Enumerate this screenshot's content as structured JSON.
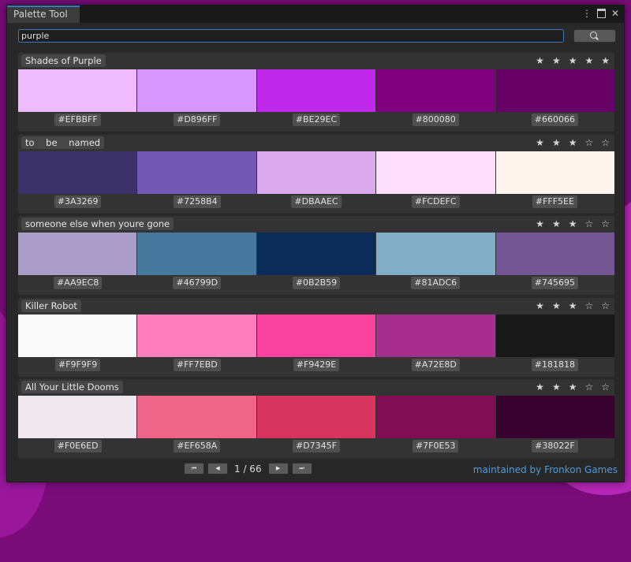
{
  "window": {
    "title": "Palette Tool",
    "menu_icon": "⋮",
    "maximize_icon": "□",
    "close_icon": "✕"
  },
  "search": {
    "value": "purple"
  },
  "palettes": [
    {
      "name": "Shades of Purple",
      "rating": 5,
      "colors": [
        "#EFBBFF",
        "#D896FF",
        "#BE29EC",
        "#800080",
        "#660066"
      ]
    },
    {
      "name": "to    be    named",
      "rating": 3,
      "colors": [
        "#3A3269",
        "#7258B4",
        "#DBAAEC",
        "#FCDEFC",
        "#FFF5EE"
      ]
    },
    {
      "name": "someone else when youre gone",
      "rating": 3,
      "colors": [
        "#AA9EC8",
        "#46799D",
        "#0B2B59",
        "#81ADC6",
        "#745695"
      ]
    },
    {
      "name": "Killer Robot",
      "rating": 3,
      "colors": [
        "#F9F9F9",
        "#FF7EBD",
        "#F9429E",
        "#A72E8D",
        "#181818"
      ]
    },
    {
      "name": "All Your Little Dooms",
      "rating": 3,
      "colors": [
        "#F0E6ED",
        "#EF658A",
        "#D7345F",
        "#7F0E53",
        "#38022F"
      ]
    }
  ],
  "pagination": {
    "label": "1 / 66",
    "first_icon": "⏮",
    "prev_icon": "◀",
    "next_icon": "▶",
    "last_icon": "⏭"
  },
  "footer": {
    "maintained_by": "maintained by Fronkon Games"
  }
}
